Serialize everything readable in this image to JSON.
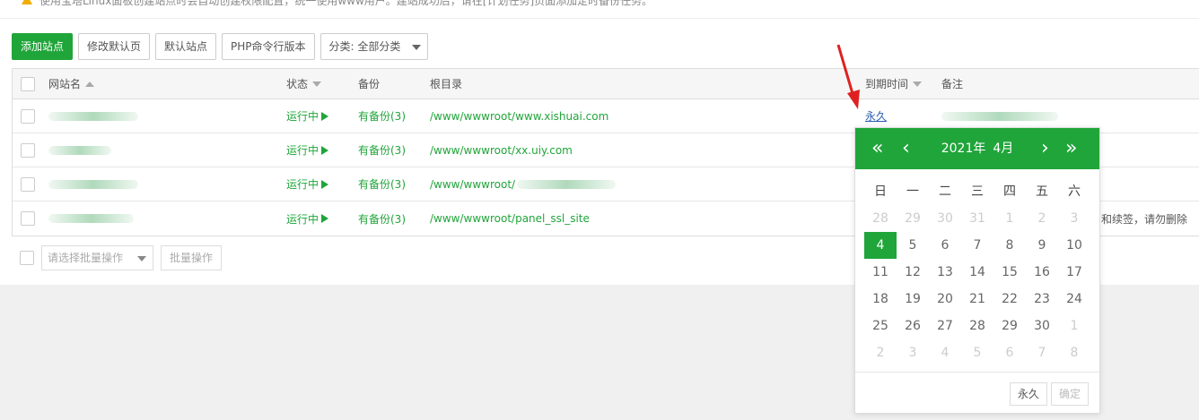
{
  "notice": {
    "text": "使用宝塔Linux面板创建站点时会自动创建权限配置，统一使用www用户。建站成功后，请在[计划任务]页面添加定时备份任务。"
  },
  "toolbar": {
    "add_site": "添加站点",
    "edit_default_page": "修改默认页",
    "default_site": "默认站点",
    "php_cli_version": "PHP命令行版本",
    "category": "分类: 全部分类"
  },
  "table": {
    "headers": {
      "name": "网站名",
      "status": "状态",
      "backup": "备份",
      "root": "根目录",
      "expire": "到期时间",
      "remark": "备注"
    },
    "rows": [
      {
        "status": "运行中",
        "backup": "有备份(3)",
        "root": "/www/wwwroot/www.xishuai.com",
        "expire": "永久",
        "remark": ""
      },
      {
        "status": "运行中",
        "backup": "有备份(3)",
        "root": "/www/wwwroot/xx.uiy.com",
        "expire": "",
        "remark": ""
      },
      {
        "status": "运行中",
        "backup": "有备份(3)",
        "root": "/www/wwwroot/",
        "expire": "",
        "remark": ""
      },
      {
        "status": "运行中",
        "backup": "有备份(3)",
        "root": "/www/wwwroot/panel_ssl_site",
        "expire": "",
        "remark": "和续签，请勿删除"
      }
    ]
  },
  "batch": {
    "placeholder": "请选择批量操作",
    "button": "批量操作"
  },
  "datepicker": {
    "prev_year": "«",
    "prev_month": "‹",
    "next_month": "›",
    "next_year": "»",
    "year": "2021年",
    "month": "4月",
    "weekdays": [
      "日",
      "一",
      "二",
      "三",
      "四",
      "五",
      "六"
    ],
    "weeks": [
      [
        {
          "d": "28",
          "o": 1
        },
        {
          "d": "29",
          "o": 1
        },
        {
          "d": "30",
          "o": 1
        },
        {
          "d": "31",
          "o": 1
        },
        {
          "d": "1",
          "o": 1
        },
        {
          "d": "2",
          "o": 1
        },
        {
          "d": "3",
          "o": 1
        }
      ],
      [
        {
          "d": "4",
          "t": 1
        },
        {
          "d": "5"
        },
        {
          "d": "6"
        },
        {
          "d": "7"
        },
        {
          "d": "8"
        },
        {
          "d": "9"
        },
        {
          "d": "10"
        }
      ],
      [
        {
          "d": "11"
        },
        {
          "d": "12"
        },
        {
          "d": "13"
        },
        {
          "d": "14"
        },
        {
          "d": "15"
        },
        {
          "d": "16"
        },
        {
          "d": "17"
        }
      ],
      [
        {
          "d": "18"
        },
        {
          "d": "19"
        },
        {
          "d": "20"
        },
        {
          "d": "21"
        },
        {
          "d": "22"
        },
        {
          "d": "23"
        },
        {
          "d": "24"
        }
      ],
      [
        {
          "d": "25"
        },
        {
          "d": "26"
        },
        {
          "d": "27"
        },
        {
          "d": "28"
        },
        {
          "d": "29"
        },
        {
          "d": "30"
        },
        {
          "d": "1",
          "o": 1
        }
      ],
      [
        {
          "d": "2",
          "o": 1
        },
        {
          "d": "3",
          "o": 1
        },
        {
          "d": "4",
          "o": 1
        },
        {
          "d": "5",
          "o": 1
        },
        {
          "d": "6",
          "o": 1
        },
        {
          "d": "7",
          "o": 1
        },
        {
          "d": "8",
          "o": 1
        }
      ]
    ],
    "permanent": "永久",
    "confirm": "确定"
  },
  "colors": {
    "accent": "#20a53a",
    "arrow": "#e02020",
    "link": "#2a5db0"
  }
}
